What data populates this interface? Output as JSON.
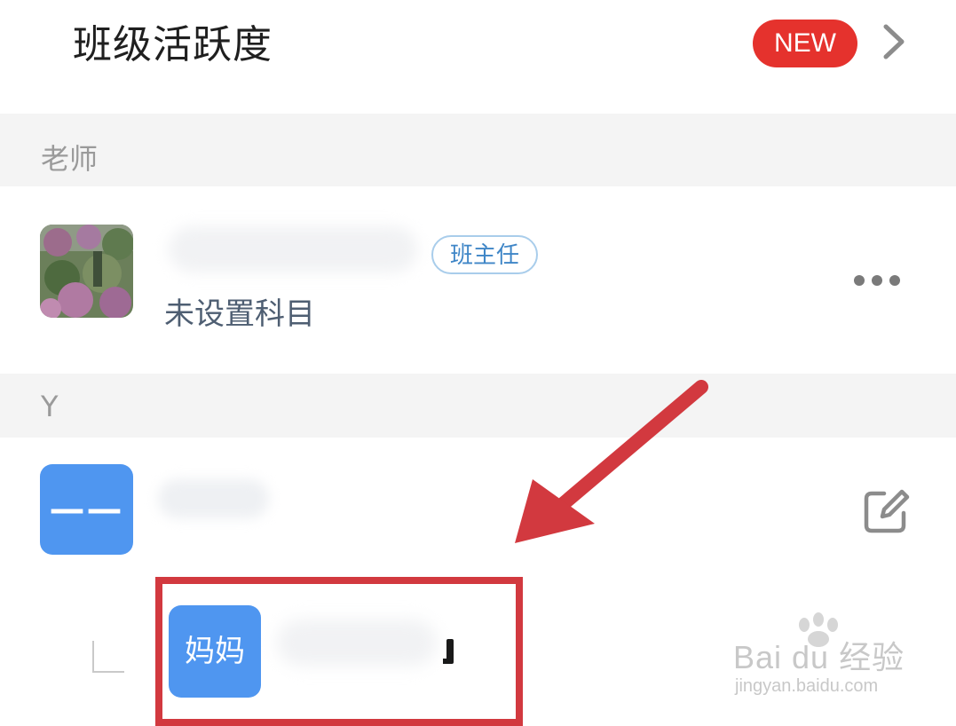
{
  "header": {
    "title": "班级活跃度",
    "new_badge": "NEW",
    "chevron_icon": "chevron-right-icon"
  },
  "sections": {
    "teachers": {
      "label": "老师"
    },
    "students": {
      "label": "Y"
    }
  },
  "teacher": {
    "role": "班主任",
    "subject": "未设置科目",
    "more_icon": "more-horizontal-icon"
  },
  "student": {
    "avatar_text": "——",
    "edit_icon": "edit-icon"
  },
  "parent": {
    "badge": "妈妈"
  },
  "watermark": {
    "main": "Bai du 经验",
    "sub": "jingyan.baidu.com"
  },
  "colors": {
    "accent_blue": "#4f96f0",
    "new_red": "#e5322d",
    "annotation_red": "#d2393f"
  }
}
